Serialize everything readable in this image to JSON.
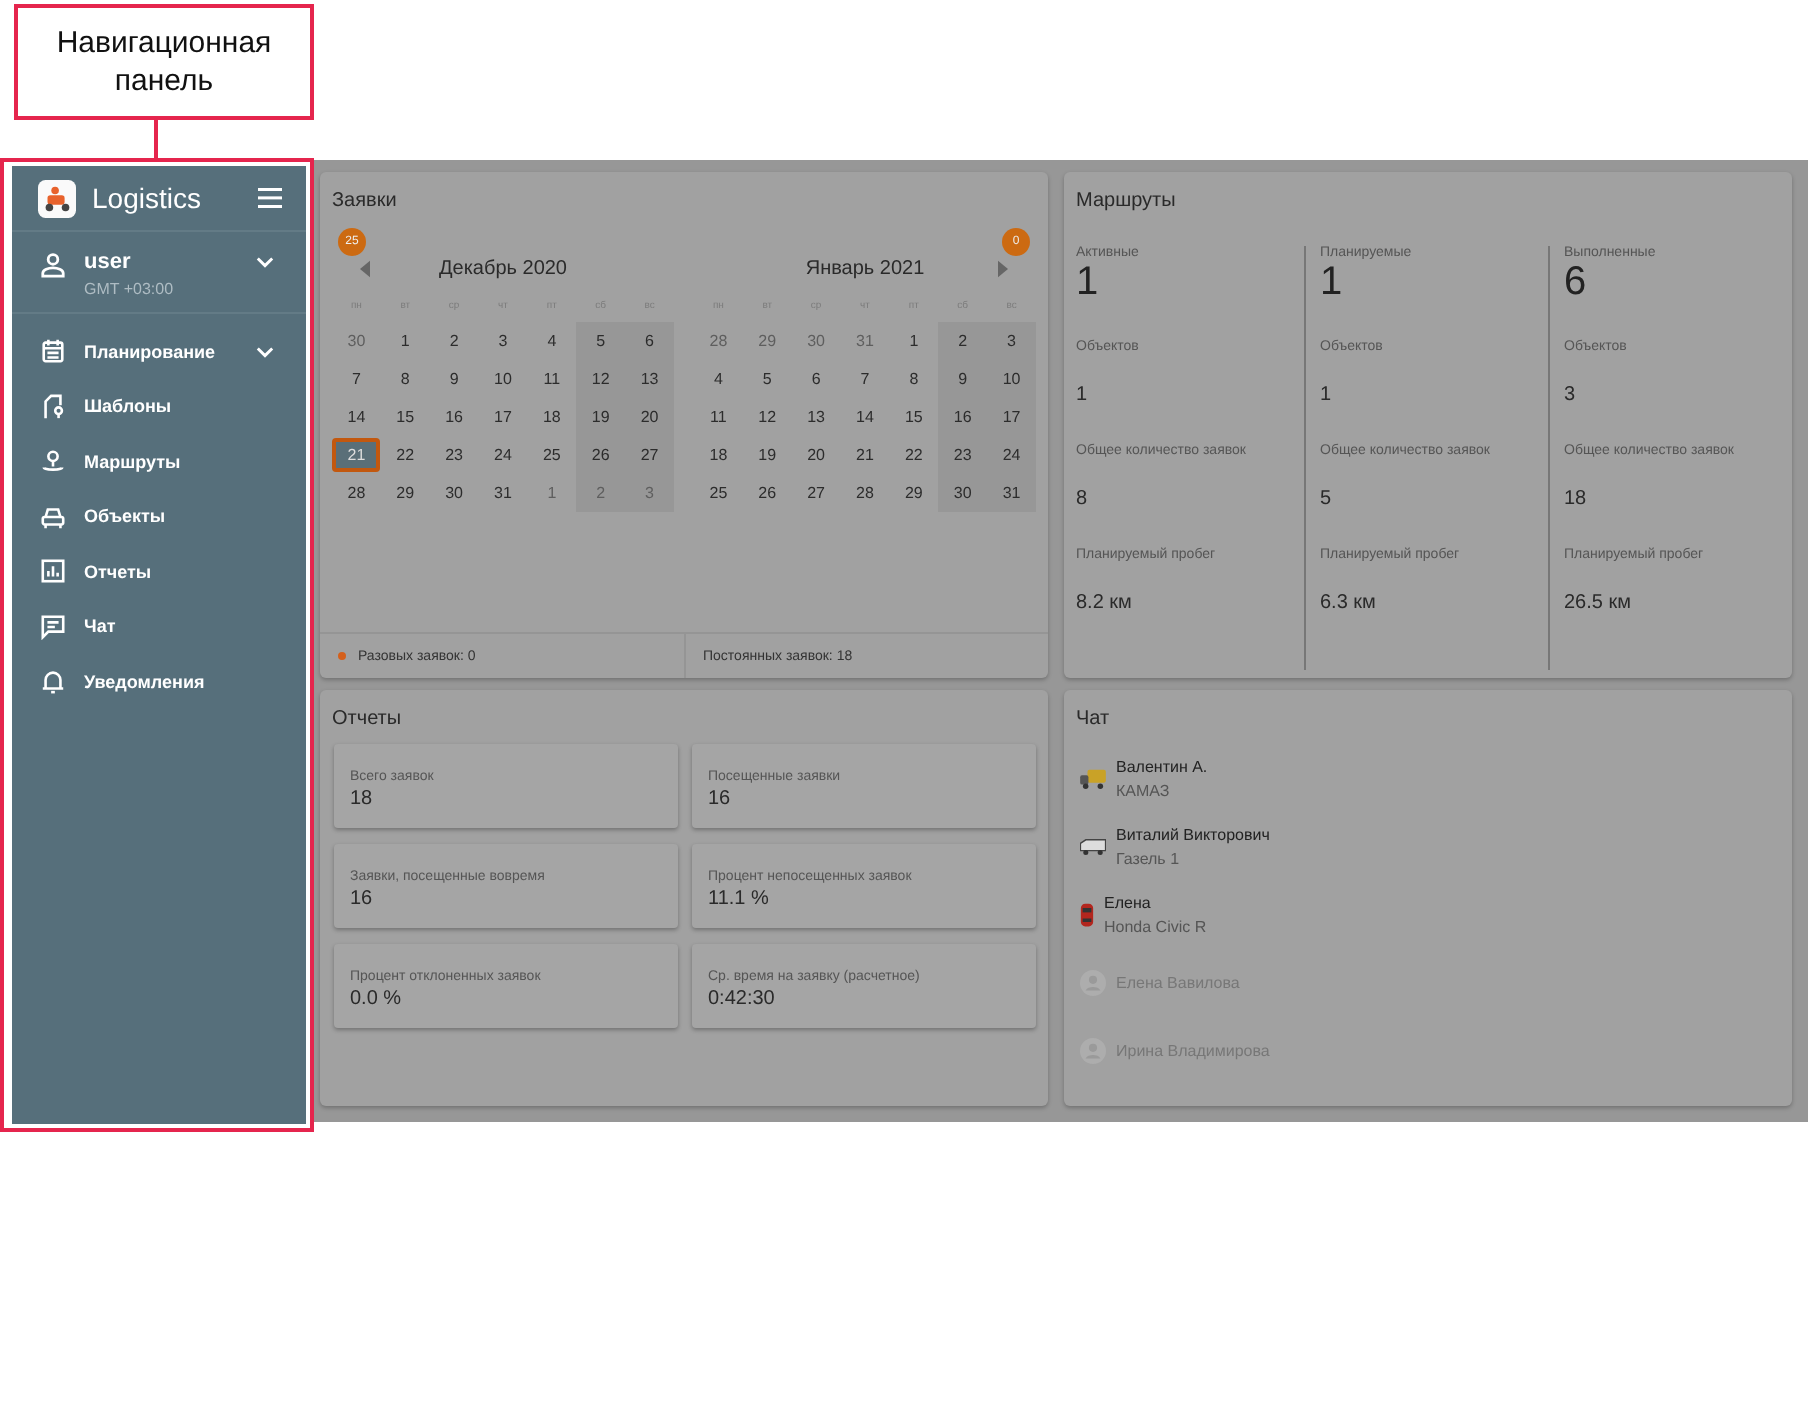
{
  "callout": {
    "text": "Навигационная панель"
  },
  "sidebar": {
    "app_name": "Logistics",
    "user": {
      "name": "user",
      "timezone": "GMT +03:00",
      "expanded": false
    },
    "items": [
      {
        "label": "Планирование",
        "has_submenu": true,
        "expanded": false,
        "selected": false
      },
      {
        "label": "Шаблоны",
        "has_submenu": false,
        "selected": false
      },
      {
        "label": "Маршруты",
        "has_submenu": false,
        "selected": false
      },
      {
        "label": "Объекты",
        "has_submenu": false,
        "selected": false
      },
      {
        "label": "Отчеты",
        "has_submenu": false,
        "selected": false
      },
      {
        "label": "Чат",
        "has_submenu": false,
        "selected": false
      },
      {
        "label": "Уведомления",
        "has_submenu": false,
        "selected": false
      }
    ]
  },
  "orders": {
    "title": "Заявки",
    "months": [
      {
        "title": "Декабрь 2020",
        "badge": "25",
        "weekdays": [
          "пн",
          "вт",
          "ср",
          "чт",
          "пт",
          "сб",
          "вс"
        ],
        "weeks": [
          [
            {
              "d": "30",
              "muted": true,
              "selected": false
            },
            {
              "d": "1",
              "muted": false,
              "selected": false
            },
            {
              "d": "2",
              "muted": false,
              "selected": false
            },
            {
              "d": "3",
              "muted": false,
              "selected": false
            },
            {
              "d": "4",
              "muted": false,
              "selected": false
            },
            {
              "d": "5",
              "muted": false,
              "selected": false
            },
            {
              "d": "6",
              "muted": false,
              "selected": false
            }
          ],
          [
            {
              "d": "7",
              "muted": false,
              "selected": false
            },
            {
              "d": "8",
              "muted": false,
              "selected": false
            },
            {
              "d": "9",
              "muted": false,
              "selected": false
            },
            {
              "d": "10",
              "muted": false,
              "selected": false
            },
            {
              "d": "11",
              "muted": false,
              "selected": false
            },
            {
              "d": "12",
              "muted": false,
              "selected": false
            },
            {
              "d": "13",
              "muted": false,
              "selected": false
            }
          ],
          [
            {
              "d": "14",
              "muted": false,
              "selected": false
            },
            {
              "d": "15",
              "muted": false,
              "selected": false
            },
            {
              "d": "16",
              "muted": false,
              "selected": false
            },
            {
              "d": "17",
              "muted": false,
              "selected": false
            },
            {
              "d": "18",
              "muted": false,
              "selected": false
            },
            {
              "d": "19",
              "muted": false,
              "selected": false
            },
            {
              "d": "20",
              "muted": false,
              "selected": false
            }
          ],
          [
            {
              "d": "21",
              "muted": false,
              "selected": true
            },
            {
              "d": "22",
              "muted": false,
              "selected": false
            },
            {
              "d": "23",
              "muted": false,
              "selected": false
            },
            {
              "d": "24",
              "muted": false,
              "selected": false
            },
            {
              "d": "25",
              "muted": false,
              "selected": false
            },
            {
              "d": "26",
              "muted": false,
              "selected": false
            },
            {
              "d": "27",
              "muted": false,
              "selected": false
            }
          ],
          [
            {
              "d": "28",
              "muted": false,
              "selected": false
            },
            {
              "d": "29",
              "muted": false,
              "selected": false
            },
            {
              "d": "30",
              "muted": false,
              "selected": false
            },
            {
              "d": "31",
              "muted": false,
              "selected": false
            },
            {
              "d": "1",
              "muted": true,
              "selected": false
            },
            {
              "d": "2",
              "muted": true,
              "selected": false
            },
            {
              "d": "3",
              "muted": true,
              "selected": false
            }
          ]
        ]
      },
      {
        "title": "Январь 2021",
        "badge": "0",
        "weekdays": [
          "пн",
          "вт",
          "ср",
          "чт",
          "пт",
          "сб",
          "вс"
        ],
        "weeks": [
          [
            {
              "d": "28",
              "muted": true,
              "selected": false
            },
            {
              "d": "29",
              "muted": true,
              "selected": false
            },
            {
              "d": "30",
              "muted": true,
              "selected": false
            },
            {
              "d": "31",
              "muted": true,
              "selected": false
            },
            {
              "d": "1",
              "muted": false,
              "selected": false
            },
            {
              "d": "2",
              "muted": false,
              "selected": false
            },
            {
              "d": "3",
              "muted": false,
              "selected": false
            }
          ],
          [
            {
              "d": "4",
              "muted": false,
              "selected": false
            },
            {
              "d": "5",
              "muted": false,
              "selected": false
            },
            {
              "d": "6",
              "muted": false,
              "selected": false
            },
            {
              "d": "7",
              "muted": false,
              "selected": false
            },
            {
              "d": "8",
              "muted": false,
              "selected": false
            },
            {
              "d": "9",
              "muted": false,
              "selected": false
            },
            {
              "d": "10",
              "muted": false,
              "selected": false
            }
          ],
          [
            {
              "d": "11",
              "muted": false,
              "selected": false
            },
            {
              "d": "12",
              "muted": false,
              "selected": false
            },
            {
              "d": "13",
              "muted": false,
              "selected": false
            },
            {
              "d": "14",
              "muted": false,
              "selected": false
            },
            {
              "d": "15",
              "muted": false,
              "selected": false
            },
            {
              "d": "16",
              "muted": false,
              "selected": false
            },
            {
              "d": "17",
              "muted": false,
              "selected": false
            }
          ],
          [
            {
              "d": "18",
              "muted": false,
              "selected": false
            },
            {
              "d": "19",
              "muted": false,
              "selected": false
            },
            {
              "d": "20",
              "muted": false,
              "selected": false
            },
            {
              "d": "21",
              "muted": false,
              "selected": false
            },
            {
              "d": "22",
              "muted": false,
              "selected": false
            },
            {
              "d": "23",
              "muted": false,
              "selected": false
            },
            {
              "d": "24",
              "muted": false,
              "selected": false
            }
          ],
          [
            {
              "d": "25",
              "muted": false,
              "selected": false
            },
            {
              "d": "26",
              "muted": false,
              "selected": false
            },
            {
              "d": "27",
              "muted": false,
              "selected": false
            },
            {
              "d": "28",
              "muted": false,
              "selected": false
            },
            {
              "d": "29",
              "muted": false,
              "selected": false
            },
            {
              "d": "30",
              "muted": false,
              "selected": false
            },
            {
              "d": "31",
              "muted": false,
              "selected": false
            }
          ]
        ]
      }
    ],
    "footer": [
      {
        "text": "Разовых заявок: 0",
        "dot": true
      },
      {
        "text": "Постоянных заявок: 18",
        "dot": false
      }
    ]
  },
  "routes": {
    "title": "Маршруты",
    "columns": [
      {
        "label": "Активные",
        "value": "1",
        "stats": [
          {
            "label": "Объектов",
            "value": "1"
          },
          {
            "label": "Общее количество заявок",
            "value": "8"
          },
          {
            "label": "Планируемый пробег",
            "value": "8.2 км"
          }
        ]
      },
      {
        "label": "Планируемые",
        "value": "1",
        "stats": [
          {
            "label": "Объектов",
            "value": "1"
          },
          {
            "label": "Общее количество заявок",
            "value": "5"
          },
          {
            "label": "Планируемый пробег",
            "value": "6.3 км"
          }
        ]
      },
      {
        "label": "Выполненные",
        "value": "6",
        "stats": [
          {
            "label": "Объектов",
            "value": "3"
          },
          {
            "label": "Общее количество заявок",
            "value": "18"
          },
          {
            "label": "Планируемый пробег",
            "value": "26.5 км"
          }
        ]
      }
    ]
  },
  "reports": {
    "title": "Отчеты",
    "tiles": [
      {
        "label": "Всего заявок",
        "value": "18"
      },
      {
        "label": "Посещенные заявки",
        "value": "16"
      },
      {
        "label": "Заявки, посещенные вовремя",
        "value": "16"
      },
      {
        "label": "Процент непосещенных заявок",
        "value": "11.1 %"
      },
      {
        "label": "Процент отклоненных заявок",
        "value": "0.0 %"
      },
      {
        "label": "Ср. время на заявку (расчетное)",
        "value": "0:42:30"
      }
    ]
  },
  "chat": {
    "title": "Чат",
    "contacts": [
      {
        "kind": "truck",
        "name": "Валентин А.",
        "vehicle": "КАМАЗ",
        "active": true
      },
      {
        "kind": "van",
        "name": "Виталий Викторович",
        "vehicle": "Газель 1",
        "active": true
      },
      {
        "kind": "car",
        "name": "Елена",
        "vehicle": "Honda Civic R",
        "active": true
      },
      {
        "kind": "person",
        "name": "Елена Вавилова",
        "active": false
      },
      {
        "kind": "person",
        "name": "Ирина Владимирова",
        "active": false
      }
    ]
  }
}
